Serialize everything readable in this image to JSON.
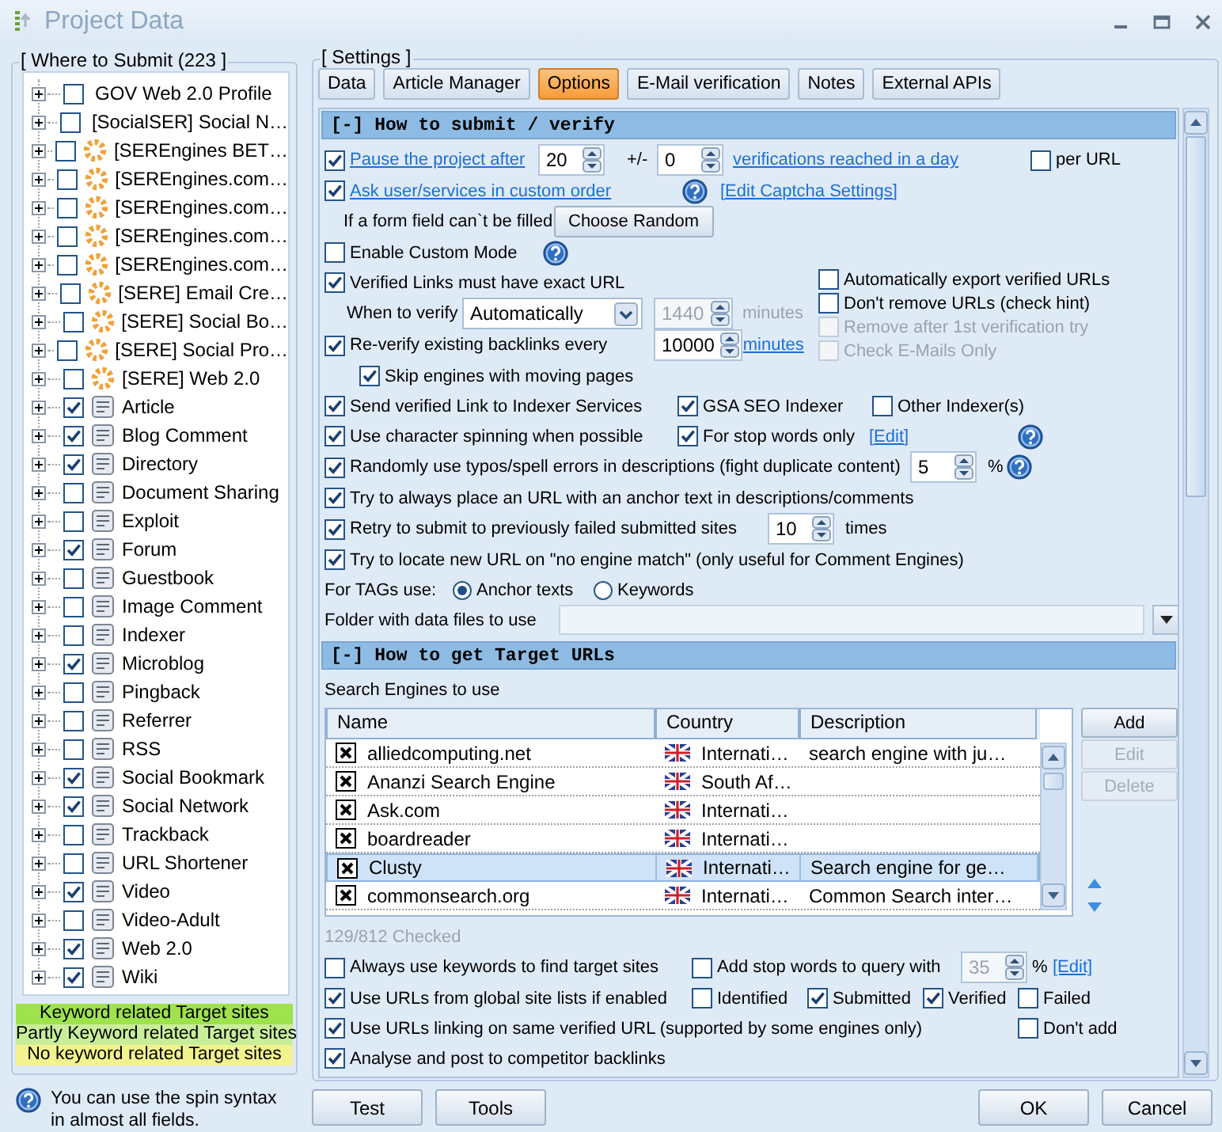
{
  "window": {
    "title": "Project Data"
  },
  "where_to_submit": {
    "title": "[ Where to Submit  (223 ]",
    "items": [
      {
        "label": "GOV Web 2.0 Profile",
        "checked": false,
        "kind": "plain"
      },
      {
        "label": "[SocialSER] Social N…",
        "checked": false,
        "kind": "plain"
      },
      {
        "label": "[SEREngines BET…",
        "checked": false,
        "kind": "engine"
      },
      {
        "label": "[SEREngines.com…",
        "checked": false,
        "kind": "engine"
      },
      {
        "label": "[SEREngines.com…",
        "checked": false,
        "kind": "engine"
      },
      {
        "label": "[SEREngines.com…",
        "checked": false,
        "kind": "engine"
      },
      {
        "label": "[SEREngines.com…",
        "checked": false,
        "kind": "engine"
      },
      {
        "label": "[SERE] Email Cre…",
        "checked": false,
        "kind": "engine"
      },
      {
        "label": "[SERE] Social Bo…",
        "checked": false,
        "kind": "engine"
      },
      {
        "label": "[SERE] Social Pro…",
        "checked": false,
        "kind": "engine"
      },
      {
        "label": "[SERE] Web 2.0",
        "checked": false,
        "kind": "engine"
      },
      {
        "label": "Article",
        "checked": true,
        "kind": "category"
      },
      {
        "label": "Blog Comment",
        "checked": true,
        "kind": "category"
      },
      {
        "label": "Directory",
        "checked": true,
        "kind": "category"
      },
      {
        "label": "Document Sharing",
        "checked": false,
        "kind": "category"
      },
      {
        "label": "Exploit",
        "checked": false,
        "kind": "category"
      },
      {
        "label": "Forum",
        "checked": true,
        "kind": "category"
      },
      {
        "label": "Guestbook",
        "checked": false,
        "kind": "category"
      },
      {
        "label": "Image Comment",
        "checked": false,
        "kind": "category"
      },
      {
        "label": "Indexer",
        "checked": false,
        "kind": "category"
      },
      {
        "label": "Microblog",
        "checked": true,
        "kind": "category"
      },
      {
        "label": "Pingback",
        "checked": false,
        "kind": "category"
      },
      {
        "label": "Referrer",
        "checked": false,
        "kind": "category"
      },
      {
        "label": "RSS",
        "checked": false,
        "kind": "category"
      },
      {
        "label": "Social Bookmark",
        "checked": true,
        "kind": "category"
      },
      {
        "label": "Social Network",
        "checked": true,
        "kind": "category"
      },
      {
        "label": "Trackback",
        "checked": false,
        "kind": "category"
      },
      {
        "label": "URL Shortener",
        "checked": false,
        "kind": "category"
      },
      {
        "label": "Video",
        "checked": true,
        "kind": "category"
      },
      {
        "label": "Video-Adult",
        "checked": false,
        "kind": "category"
      },
      {
        "label": "Web 2.0",
        "checked": true,
        "kind": "category"
      },
      {
        "label": "Wiki",
        "checked": true,
        "kind": "category"
      }
    ]
  },
  "legend": [
    {
      "text": "Keyword related Target sites",
      "color": "#9ee24c"
    },
    {
      "text": "Partly Keyword related Target sites",
      "color": "#c8ee9a"
    },
    {
      "text": "No keyword related Target sites",
      "color": "#f2f28e"
    }
  ],
  "hint": "You can use the spin syntax in almost all fields.",
  "settings": {
    "title": "[ Settings ]",
    "tabs": [
      {
        "label": "Data",
        "selected": false
      },
      {
        "label": "Article Manager",
        "selected": false
      },
      {
        "label": "Options",
        "selected": true
      },
      {
        "label": "E-Mail verification",
        "selected": false
      },
      {
        "label": "Notes",
        "selected": false
      },
      {
        "label": "External APIs",
        "selected": false
      }
    ],
    "sections": [
      {
        "title": "[-] How to submit / verify",
        "rows": [
          {
            "kind": "options",
            "items": [
              {
                "kind": "check-link",
                "label": "Pause the project after",
                "checked": true,
                "disabled": false
              },
              {
                "kind": "spin",
                "value": "20",
                "disabled": false
              },
              {
                "kind": "text",
                "text": "+/-"
              },
              {
                "kind": "spin",
                "value": "0",
                "disabled": false
              },
              {
                "kind": "link",
                "text": "verifications reached in a day"
              },
              {
                "kind": "check",
                "label": "per URL",
                "checked": false,
                "disabled": false
              }
            ]
          },
          {
            "kind": "options",
            "items": [
              {
                "kind": "check-link",
                "label": "Ask user/services in custom order",
                "checked": true,
                "disabled": false
              },
              {
                "kind": "help"
              },
              {
                "kind": "link",
                "text": "[Edit Captcha Settings]"
              }
            ]
          },
          {
            "kind": "options",
            "items": [
              {
                "kind": "text",
                "text": "If a form field can`t be filled"
              },
              {
                "kind": "button",
                "label": "Choose Random"
              }
            ]
          },
          {
            "kind": "options",
            "items": [
              {
                "kind": "check",
                "label": "Enable Custom Mode",
                "checked": false,
                "disabled": false
              },
              {
                "kind": "help"
              }
            ]
          },
          {
            "kind": "split",
            "left": [
              {
                "kind": "options",
                "items": [
                  {
                    "kind": "check",
                    "label": "Verified Links must have exact URL",
                    "checked": true,
                    "disabled": false
                  }
                ]
              },
              {
                "kind": "options",
                "items": [
                  {
                    "kind": "text",
                    "text": "When to verify"
                  },
                  {
                    "kind": "dropdown",
                    "value": "Automatically"
                  },
                  {
                    "kind": "spin",
                    "value": "1440",
                    "disabled": true
                  },
                  {
                    "kind": "note",
                    "text": "minutes"
                  }
                ]
              },
              {
                "kind": "options",
                "items": [
                  {
                    "kind": "check",
                    "label": "Re-verify existing backlinks every",
                    "checked": true,
                    "disabled": false
                  },
                  {
                    "kind": "spin",
                    "value": "10000",
                    "disabled": false
                  },
                  {
                    "kind": "link",
                    "text": "minutes"
                  }
                ]
              },
              {
                "kind": "options",
                "items": [
                  {
                    "kind": "check",
                    "label": "Skip engines with moving pages",
                    "checked": true,
                    "disabled": false
                  }
                ]
              }
            ],
            "right": [
              {
                "kind": "options",
                "items": [
                  {
                    "kind": "check",
                    "label": "Automatically export verified URLs",
                    "checked": false,
                    "disabled": false
                  }
                ]
              },
              {
                "kind": "options",
                "items": [
                  {
                    "kind": "check",
                    "label": "Don't remove URLs (check hint)",
                    "checked": false,
                    "disabled": false
                  }
                ]
              },
              {
                "kind": "options",
                "items": [
                  {
                    "kind": "check",
                    "label": "Remove after 1st verification try",
                    "checked": false,
                    "disabled": true
                  }
                ]
              },
              {
                "kind": "options",
                "items": [
                  {
                    "kind": "check",
                    "label": "Check E-Mails Only",
                    "checked": false,
                    "disabled": true
                  }
                ]
              }
            ]
          },
          {
            "kind": "options",
            "items": [
              {
                "kind": "check",
                "label": "Send verified Link to Indexer Services",
                "checked": true,
                "disabled": false
              },
              {
                "kind": "check",
                "label": "GSA SEO Indexer",
                "checked": true,
                "disabled": false
              },
              {
                "kind": "check",
                "label": "Other Indexer(s)",
                "checked": false,
                "disabled": false
              }
            ]
          },
          {
            "kind": "options",
            "items": [
              {
                "kind": "check",
                "label": "Use character spinning when possible",
                "checked": true,
                "disabled": false
              },
              {
                "kind": "check",
                "label": "For stop words only",
                "checked": true,
                "disabled": false
              },
              {
                "kind": "link",
                "text": "[Edit]"
              },
              {
                "kind": "help"
              }
            ]
          },
          {
            "kind": "options",
            "items": [
              {
                "kind": "check",
                "label": "Randomly use typos/spell errors in descriptions (fight duplicate content)",
                "checked": true,
                "disabled": false
              },
              {
                "kind": "spin",
                "value": "5",
                "disabled": false
              },
              {
                "kind": "text",
                "text": "%"
              },
              {
                "kind": "help"
              }
            ]
          },
          {
            "kind": "options",
            "items": [
              {
                "kind": "check",
                "label": "Try to always place an URL with an anchor text in descriptions/comments",
                "checked": true,
                "disabled": false
              }
            ]
          },
          {
            "kind": "options",
            "items": [
              {
                "kind": "check",
                "label": "Retry to submit to previously failed submitted sites",
                "checked": true,
                "disabled": false
              },
              {
                "kind": "spin",
                "value": "10",
                "disabled": false
              },
              {
                "kind": "text",
                "text": "times"
              }
            ]
          },
          {
            "kind": "options",
            "items": [
              {
                "kind": "check",
                "label": "Try to locate new URL on \"no engine match\" (only useful for Comment Engines)",
                "checked": true,
                "disabled": false
              }
            ]
          },
          {
            "kind": "options",
            "items": [
              {
                "kind": "text",
                "text": "For TAGs use:"
              },
              {
                "kind": "radio",
                "label": "Anchor texts",
                "selected": true
              },
              {
                "kind": "radio",
                "label": "Keywords",
                "selected": false
              }
            ]
          },
          {
            "kind": "options",
            "items": [
              {
                "kind": "text",
                "text": "Folder with data files to use"
              },
              {
                "kind": "field"
              },
              {
                "kind": "dropbutton"
              }
            ]
          }
        ]
      },
      {
        "title": "[-] How to get Target URLs",
        "rows": [
          {
            "kind": "caption",
            "text": "Search Engines to use"
          },
          {
            "kind": "table",
            "columns": [
              "Name",
              "Country",
              "Description"
            ],
            "rows": [
              {
                "checked": true,
                "name": "alliedcomputing.net",
                "country": "Internati…",
                "description": "search engine with ju…",
                "selected": false
              },
              {
                "checked": true,
                "name": "Ananzi Search Engine",
                "country": "South Af…",
                "selected": false
              },
              {
                "checked": true,
                "name": "Ask.com",
                "country": "Internati…",
                "selected": false
              },
              {
                "checked": true,
                "name": "boardreader",
                "country": "Internati…",
                "selected": false
              },
              {
                "checked": true,
                "name": "Clusty",
                "country": "Internati…",
                "description": "Search engine for ge…",
                "selected": true
              },
              {
                "checked": true,
                "name": "commonsearch.org",
                "country": "Internati…",
                "description": "Common Search inter…",
                "selected": false
              }
            ],
            "buttons": [
              {
                "label": "Add",
                "disabled": false
              },
              {
                "label": "Edit",
                "disabled": true
              },
              {
                "label": "Delete",
                "disabled": true
              }
            ]
          },
          {
            "kind": "note",
            "text": "129/812 Checked"
          },
          {
            "kind": "options",
            "items": [
              {
                "kind": "check",
                "label": "Always use keywords to find target sites",
                "checked": false,
                "disabled": false
              },
              {
                "kind": "check",
                "label": "Add stop words to query with",
                "checked": false,
                "disabled": false
              },
              {
                "kind": "spin",
                "value": "35",
                "disabled": true
              },
              {
                "kind": "text",
                "text": "%"
              },
              {
                "kind": "link",
                "text": "[Edit]"
              }
            ]
          },
          {
            "kind": "options",
            "items": [
              {
                "kind": "check",
                "label": "Use URLs from global site lists if enabled",
                "checked": true,
                "disabled": false
              },
              {
                "kind": "check",
                "label": "Identified",
                "checked": false,
                "disabled": false
              },
              {
                "kind": "check",
                "label": "Submitted",
                "checked": true,
                "disabled": false
              },
              {
                "kind": "check",
                "label": "Verified",
                "checked": true,
                "disabled": false
              },
              {
                "kind": "check",
                "label": "Failed",
                "checked": false,
                "disabled": false
              }
            ]
          },
          {
            "kind": "options",
            "items": [
              {
                "kind": "check",
                "label": "Use URLs linking on same verified URL (supported by some engines only)",
                "checked": true,
                "disabled": false
              },
              {
                "kind": "check",
                "label": "Don't add",
                "checked": false,
                "disabled": false
              }
            ]
          },
          {
            "kind": "options",
            "items": [
              {
                "kind": "check",
                "label": "Analyse and post to competitor backlinks",
                "checked": true,
                "disabled": false
              }
            ]
          }
        ]
      }
    ]
  },
  "footer": {
    "left": [
      "Test",
      "Tools"
    ],
    "right": [
      "OK",
      "Cancel"
    ]
  }
}
